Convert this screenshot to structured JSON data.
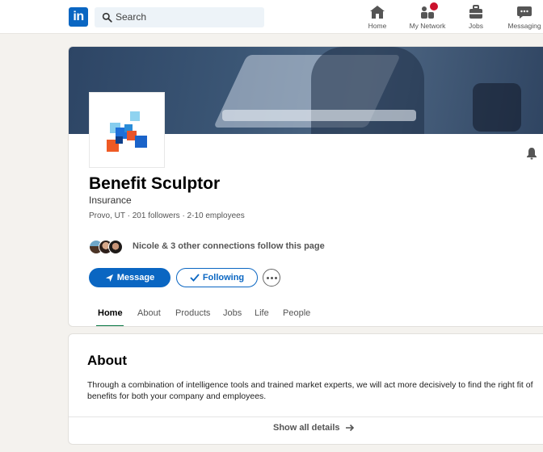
{
  "nav": {
    "logo_text": "in",
    "search_placeholder": "Search",
    "items": [
      {
        "label": "Home",
        "icon": "home-icon"
      },
      {
        "label": "My Network",
        "icon": "my-network-icon"
      },
      {
        "label": "Jobs",
        "icon": "jobs-icon"
      },
      {
        "label": "Messaging",
        "icon": "messaging-icon"
      }
    ]
  },
  "company": {
    "name": "Benefit Sculptor",
    "industry": "Insurance",
    "location": "Provo, UT",
    "followers": "201 followers",
    "employees": "2-10 employees",
    "connections_text": "Nicole & 3 other connections follow this page"
  },
  "actions": {
    "message_label": "Message",
    "following_label": "Following",
    "more_icon": "more-icon"
  },
  "tabs": [
    {
      "label": "Home",
      "active": true
    },
    {
      "label": "About",
      "active": false
    },
    {
      "label": "Products",
      "active": false
    },
    {
      "label": "Jobs",
      "active": false
    },
    {
      "label": "Life",
      "active": false
    },
    {
      "label": "People",
      "active": false
    }
  ],
  "about": {
    "title": "About",
    "text": "Through a combination of intelligence tools and trained market experts, we will act more decisively to find the right fit of benefits for both your company and employees.",
    "show_all": "Show all details"
  },
  "colors": {
    "brand": "#0a66c2",
    "active_tab": "#057642",
    "notification": "#cb112d",
    "background": "#f4f2ee"
  }
}
